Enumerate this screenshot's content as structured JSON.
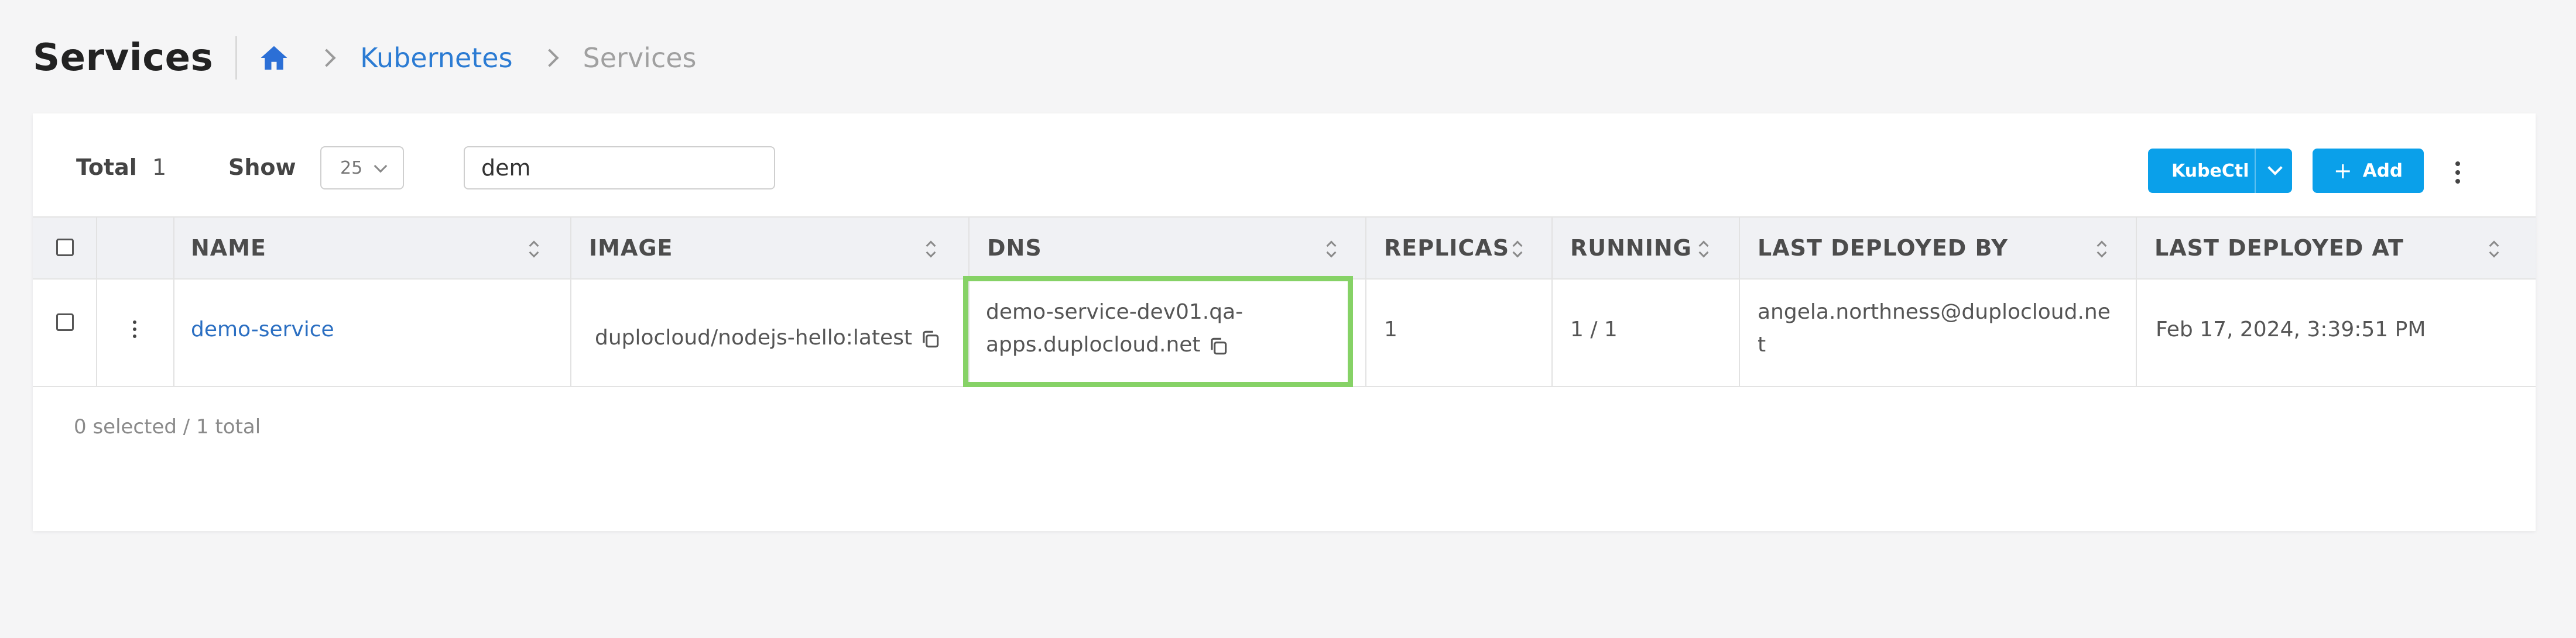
{
  "header": {
    "title": "Services",
    "breadcrumb": {
      "home_icon": "home-icon",
      "items": [
        {
          "label": "Kubernetes",
          "link": true
        },
        {
          "label": "Services",
          "link": false
        }
      ]
    }
  },
  "toolbar": {
    "total_label": "Total",
    "total_value": "1",
    "show_label": "Show",
    "page_size": "25",
    "search_value": "dem",
    "kubectl_label": "KubeCtl",
    "add_label": "Add"
  },
  "table": {
    "columns": [
      "NAME",
      "IMAGE",
      "DNS",
      "REPLICAS",
      "RUNNING",
      "LAST DEPLOYED BY",
      "LAST DEPLOYED AT"
    ],
    "rows": [
      {
        "name": "demo-service",
        "image": "duplocloud/nodejs-hello:latest",
        "dns_line1": "demo-service-dev01.qa-",
        "dns_line2": "apps.duplocloud.net",
        "replicas": "1",
        "running": "1 / 1",
        "deployed_by_line1": "angela.northness@duplocloud.ne",
        "deployed_by_line2": "t",
        "deployed_at": "Feb 17, 2024, 3:39:51 PM"
      }
    ]
  },
  "footer": {
    "selection_status": "0 selected / 1 total"
  },
  "colors": {
    "accent": "#0aa0ea",
    "link": "#2b7bd3",
    "highlight": "#86d266"
  }
}
